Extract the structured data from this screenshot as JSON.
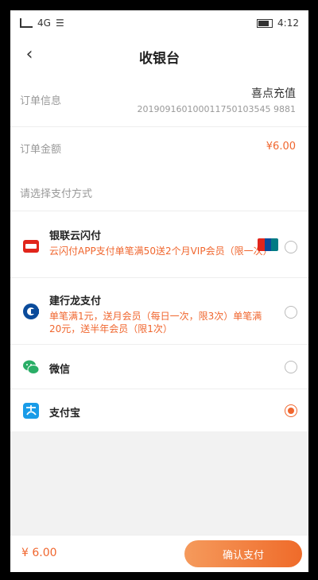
{
  "status_bar": {
    "carrier": "4G",
    "time": "4:12"
  },
  "nav": {
    "title": "收银台"
  },
  "order": {
    "info_label": "订单信息",
    "product_name": "喜点充值",
    "order_no": "201909160100011750103545 9881",
    "amount_label": "订单金额",
    "amount": "¥6.00"
  },
  "payment": {
    "header": "请选择支付方式",
    "options": [
      {
        "name": "银联云闪付",
        "desc": "云闪付APP支付单笔满50送2个月VIP会员（限一次）",
        "selected": false
      },
      {
        "name": "建行龙支付",
        "desc": "单笔满1元，送月会员（每日一次，限3次）单笔满20元，送半年会员（限1次）",
        "selected": false
      },
      {
        "name": "微信",
        "desc": "",
        "selected": false
      },
      {
        "name": "支付宝",
        "desc": "",
        "selected": true
      }
    ]
  },
  "footer": {
    "total": "¥ 6.00",
    "confirm_label": "确认支付"
  },
  "colors": {
    "accent": "#f0662e",
    "background": "#f2f2f2"
  }
}
